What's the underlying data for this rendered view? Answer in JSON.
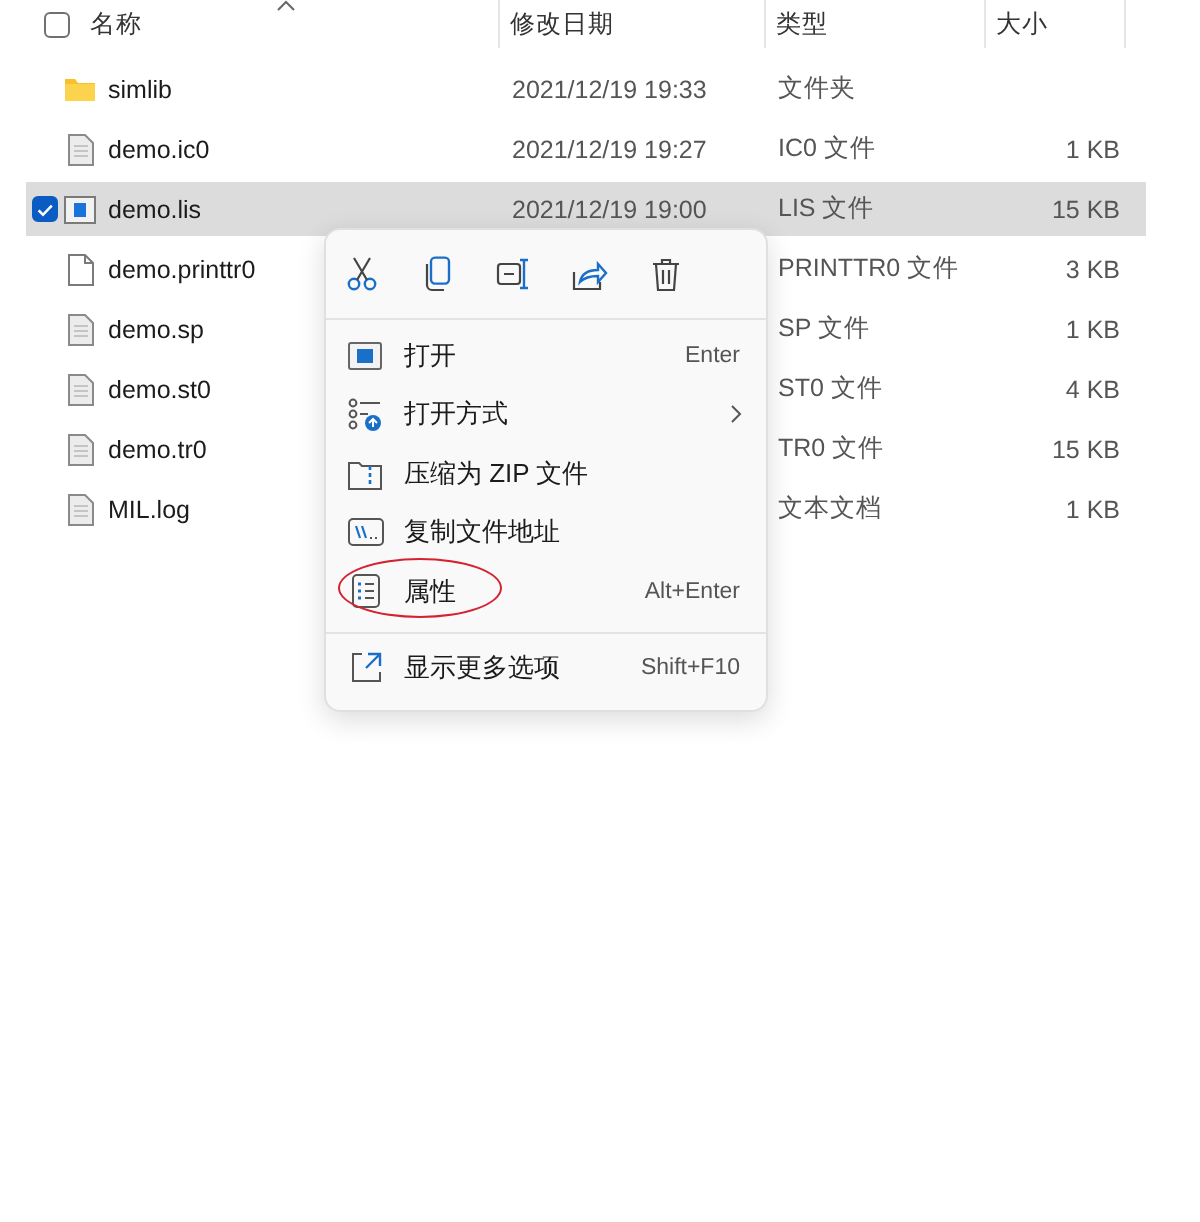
{
  "header": {
    "select_all_checked": false,
    "columns": [
      {
        "label": "名称",
        "sorted": true
      },
      {
        "label": "修改日期",
        "sorted": false
      },
      {
        "label": "类型",
        "sorted": false
      },
      {
        "label": "大小",
        "sorted": false
      }
    ]
  },
  "files": [
    {
      "kind": "folder",
      "name": "simlib",
      "modified": "2021/12/19 19:33",
      "type": "文件夹",
      "selected": false
    },
    {
      "kind": "document",
      "name": "demo.ic0",
      "modified": "2021/12/19 19:27",
      "type": "IC0 文件",
      "size": "1 KB",
      "selected": false
    },
    {
      "kind": "app",
      "name": "demo.lis",
      "modified": "2021/12/19 19:00",
      "type": "LIS 文件",
      "size": "15 KB",
      "selected": true
    },
    {
      "kind": "blank",
      "name": "demo.printtr0",
      "type": "PRINTTR0 文件",
      "size": "3 KB",
      "selected": false
    },
    {
      "kind": "document",
      "name": "demo.sp",
      "type": "SP 文件",
      "size": "1 KB",
      "selected": false
    },
    {
      "kind": "document",
      "name": "demo.st0",
      "type": "ST0 文件",
      "size": "4 KB",
      "selected": false
    },
    {
      "kind": "document",
      "name": "demo.tr0",
      "type": "TR0 文件",
      "size": "15 KB",
      "selected": false
    },
    {
      "kind": "document",
      "name": "MIL.log",
      "type": "文本文档",
      "size": "1 KB",
      "selected": false
    }
  ],
  "context_menu": {
    "toolbar": [
      {
        "kind": "cut"
      },
      {
        "kind": "copy"
      },
      {
        "kind": "rename"
      },
      {
        "kind": "share"
      },
      {
        "kind": "delete"
      }
    ],
    "items": [
      {
        "label": "打开",
        "shortcut": "Enter",
        "submenu": false,
        "highlighted": false
      },
      {
        "label": "打开方式",
        "submenu": true,
        "highlighted": false
      },
      {
        "label": "压缩为 ZIP 文件",
        "submenu": false,
        "highlighted": false
      },
      {
        "label": "复制文件地址",
        "submenu": false,
        "highlighted": false
      },
      {
        "label": "属性",
        "shortcut": "Alt+Enter",
        "submenu": false,
        "highlighted": true
      }
    ],
    "footer": {
      "label": "显示更多选项",
      "shortcut": "Shift+F10"
    }
  }
}
